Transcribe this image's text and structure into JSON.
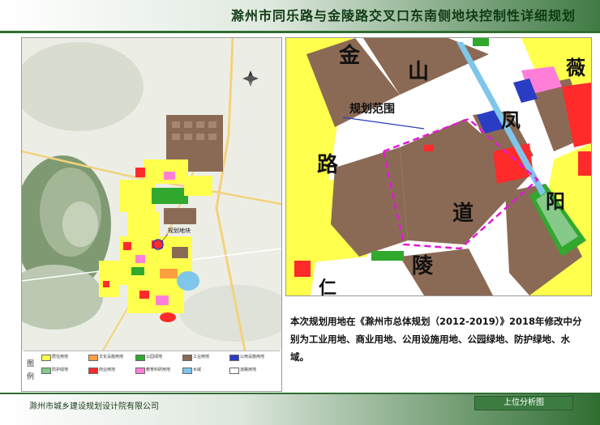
{
  "header": {
    "title": "滁州市同乐路与金陵路交叉口东南侧地块控制性详细规划"
  },
  "overview_map": {
    "site_label": "规划地块"
  },
  "zoom_map": {
    "range_label": "规划范围",
    "road_characters": [
      "金",
      "山",
      "路",
      "道",
      "陵",
      "薇",
      "凤",
      "阳",
      "仁"
    ]
  },
  "description": {
    "text": "本次规划用地在《滁州市总体规划（2012-2019）》2018年修改中分别为工业用地、商业用地、公用设施用地、公园绿地、防护绿地、水域。"
  },
  "legend": {
    "label_chars": [
      "图",
      "例"
    ],
    "items": [
      {
        "label": "居住用地",
        "color": "#ffff4d"
      },
      {
        "label": "文化设施用地",
        "color": "#ff9f3f"
      },
      {
        "label": "公园绿地",
        "color": "#31a82e"
      },
      {
        "label": "工业用地",
        "color": "#8b6a55"
      },
      {
        "label": "公用设施用地",
        "color": "#2b3cc4"
      },
      {
        "label": "防护绿地",
        "color": "#86c98a"
      },
      {
        "label": "商业用地",
        "color": "#ff2a2a"
      },
      {
        "label": "教育科研用地",
        "color": "#ff7fd8"
      },
      {
        "label": "水域",
        "color": "#7fc6ea"
      },
      {
        "label": "道路用地",
        "color": "#ffffff"
      }
    ]
  },
  "footer": {
    "org": "滁州市城乡建设规划设计院有限公司",
    "section": "上位分析图"
  }
}
